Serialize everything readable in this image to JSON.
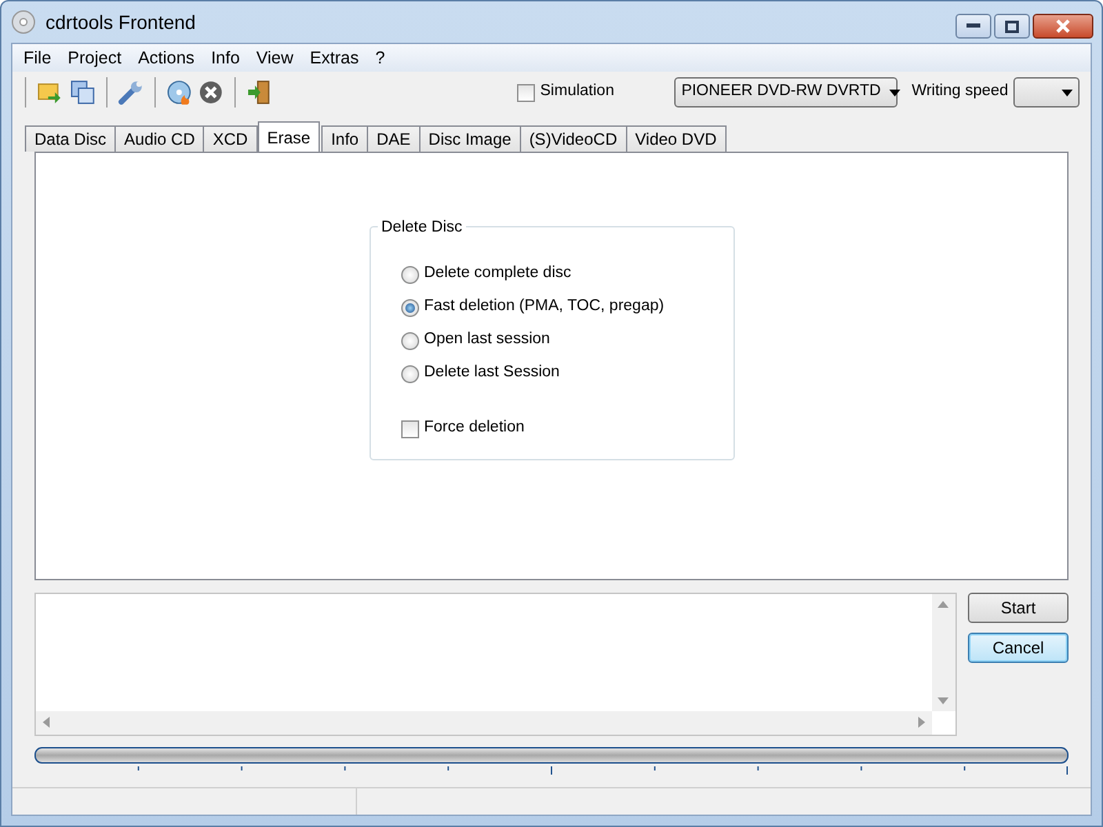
{
  "window": {
    "title": "cdrtools Frontend"
  },
  "menu": [
    "File",
    "Project",
    "Actions",
    "Info",
    "View",
    "Extras",
    "?"
  ],
  "toolbar": {
    "simulation": {
      "label": "Simulation",
      "checked": false
    },
    "drive": "PIONEER DVD-RW DVRTD",
    "writing_speed_label": "Writing speed"
  },
  "tabs": [
    {
      "label": "Data Disc",
      "selected": false
    },
    {
      "label": "Audio CD",
      "selected": false
    },
    {
      "label": "XCD",
      "selected": false
    },
    {
      "label": "Erase",
      "selected": true
    },
    {
      "label": "Info",
      "selected": false
    },
    {
      "label": "DAE",
      "selected": false
    },
    {
      "label": "Disc Image",
      "selected": false
    },
    {
      "label": "(S)VideoCD",
      "selected": false
    },
    {
      "label": "Video DVD",
      "selected": false
    }
  ],
  "delete_disc": {
    "title": "Delete Disc",
    "options": [
      {
        "label": "Delete complete disc",
        "selected": false
      },
      {
        "label": "Fast deletion (PMA, TOC, pregap)",
        "selected": true
      },
      {
        "label": "Open last session",
        "selected": false
      },
      {
        "label": "Delete last Session",
        "selected": false
      }
    ],
    "force": {
      "label": "Force deletion",
      "checked": false
    }
  },
  "buttons": [
    {
      "label": "Start",
      "focused": false
    },
    {
      "label": "Cancel",
      "focused": true
    }
  ]
}
